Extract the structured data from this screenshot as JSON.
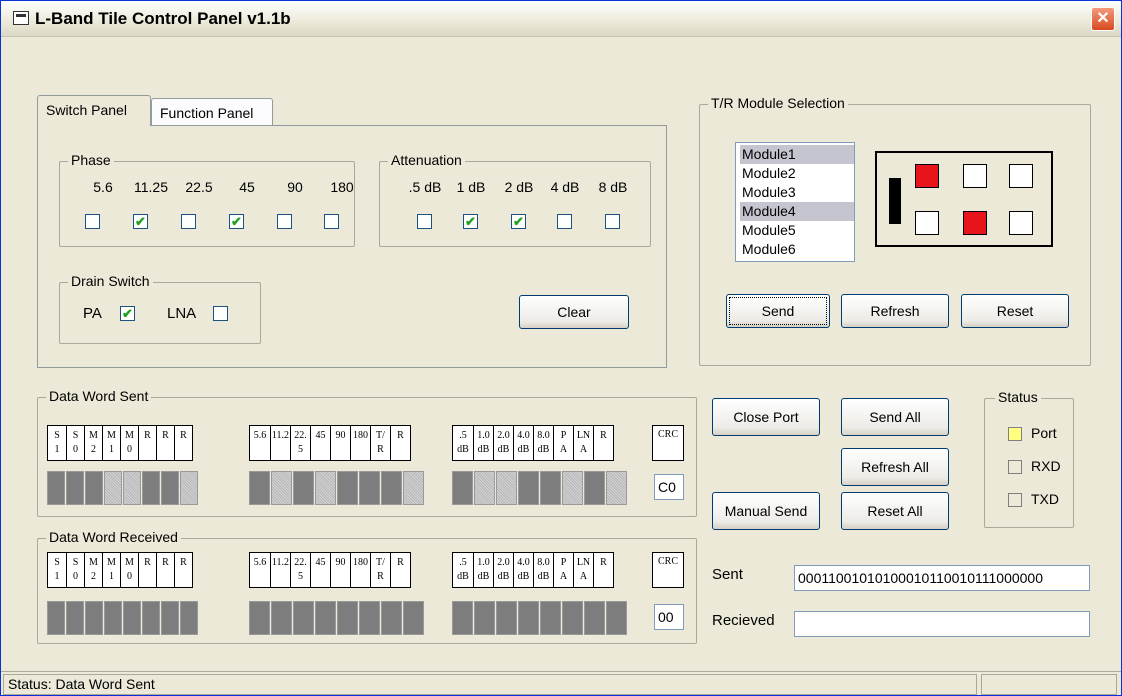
{
  "window": {
    "title": "L-Band Tile Control Panel v1.1b",
    "close_glyph": "✕"
  },
  "tabs": [
    {
      "label": "Switch Panel",
      "active": true
    },
    {
      "label": "Function Panel",
      "active": false
    }
  ],
  "phase": {
    "label": "Phase",
    "values": [
      "5.6",
      "11.25",
      "22.5",
      "45",
      "90",
      "180"
    ],
    "checked": [
      false,
      true,
      false,
      true,
      false,
      false
    ]
  },
  "attenuation": {
    "label": "Attenuation",
    "values": [
      ".5 dB",
      "1 dB",
      "2 dB",
      "4 dB",
      "8 dB"
    ],
    "checked": [
      false,
      true,
      true,
      false,
      false
    ]
  },
  "drain": {
    "label": "Drain Switch",
    "pa_label": "PA",
    "pa_checked": true,
    "lna_label": "LNA",
    "lna_checked": false
  },
  "clear_button": "Clear",
  "tr_module": {
    "label": "T/R Module Selection",
    "modules": [
      "Module1",
      "Module2",
      "Module3",
      "Module4",
      "Module5",
      "Module6"
    ],
    "selected": [
      true,
      false,
      false,
      true,
      false,
      false
    ],
    "grid_active": [
      true,
      false,
      false,
      false,
      true,
      false
    ],
    "send_button": "Send",
    "refresh_button": "Refresh",
    "reset_button": "Reset"
  },
  "word_headers": {
    "g1": [
      "S\n1",
      "S\n0",
      "M\n2",
      "M\n1",
      "M\n0",
      "R",
      "R",
      "R"
    ],
    "g2": [
      "5.6",
      "11.2",
      "22.\n5",
      "45",
      "90",
      "180",
      "T/\nR",
      "R"
    ],
    "g3": [
      ".5\ndB",
      "1.0\ndB",
      "2.0\ndB",
      "4.0\ndB",
      "8.0\ndB",
      "P\nA",
      "LN\nA",
      "R"
    ],
    "crc": "CRC"
  },
  "data_word_sent": {
    "label": "Data Word Sent",
    "bits": [
      0,
      0,
      0,
      1,
      1,
      0,
      0,
      1,
      0,
      1,
      0,
      1,
      0,
      0,
      0,
      1,
      0,
      1,
      1,
      0,
      0,
      1,
      0,
      1,
      1,
      1,
      0,
      0,
      0,
      0,
      0,
      0
    ],
    "crc": "C0"
  },
  "data_word_received": {
    "label": "Data Word Received",
    "bits": [
      0,
      0,
      0,
      0,
      0,
      0,
      0,
      0,
      0,
      0,
      0,
      0,
      0,
      0,
      0,
      0,
      0,
      0,
      0,
      0,
      0,
      0,
      0,
      0,
      0,
      0,
      0,
      0,
      0,
      0,
      0,
      0
    ],
    "crc": "00"
  },
  "buttons": {
    "close_port": "Close Port",
    "send_all": "Send All",
    "refresh_all": "Refresh All",
    "manual_send": "Manual Send",
    "reset_all": "Reset All"
  },
  "status": {
    "label": "Status",
    "port": "Port",
    "rxd": "RXD",
    "txd": "TXD",
    "port_color": "#ffff80"
  },
  "sent_field": {
    "label": "Sent",
    "value": "00011001010100010110010111000000"
  },
  "received_field": {
    "label": "Recieved",
    "value": ""
  },
  "statusbar": {
    "text": "Status: Data Word Sent"
  }
}
